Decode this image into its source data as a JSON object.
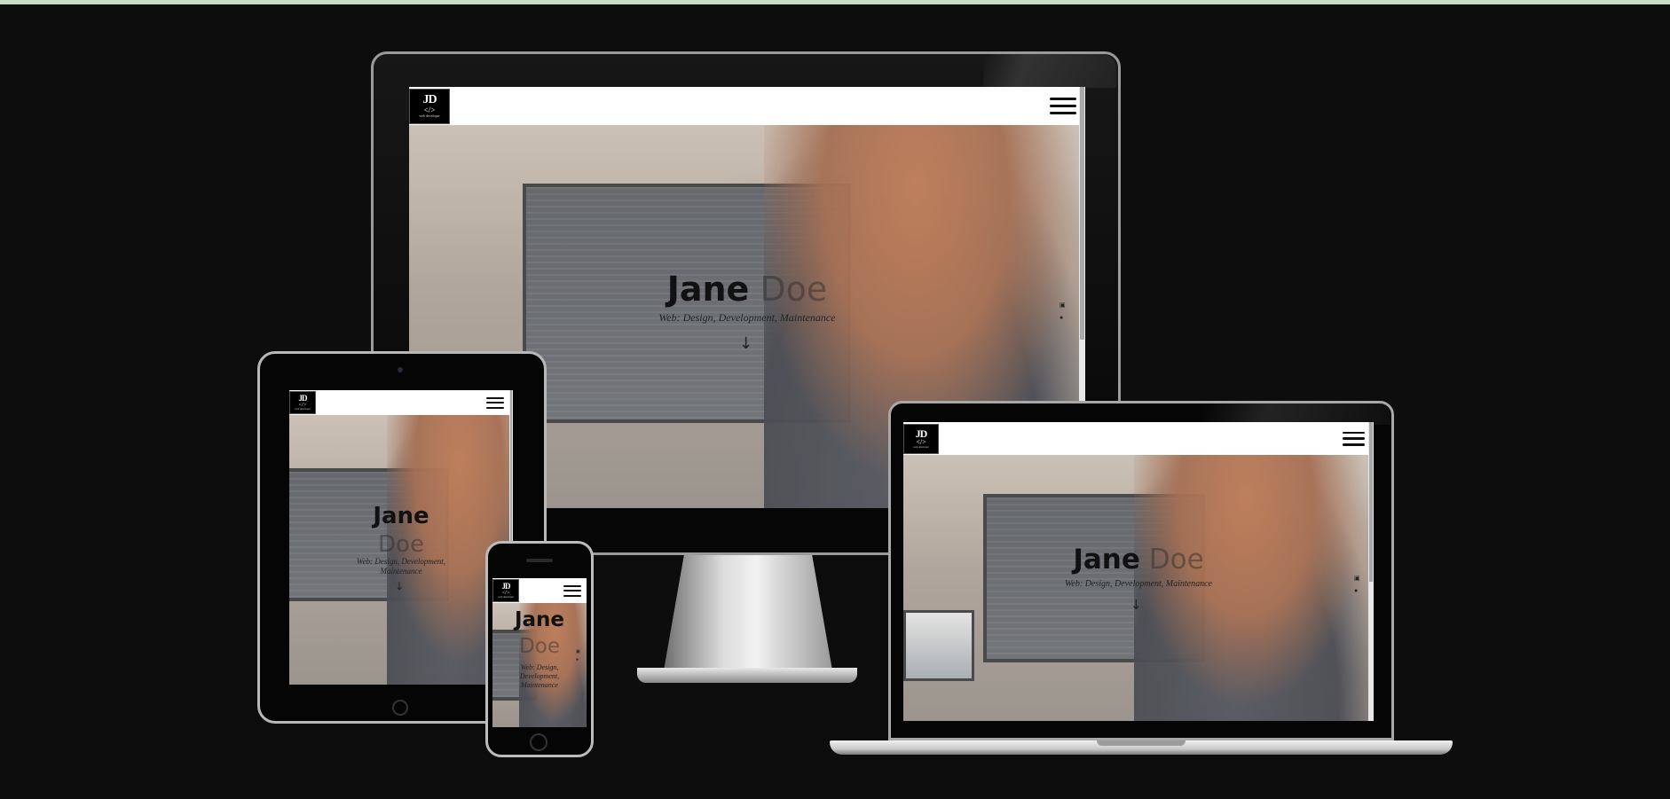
{
  "site": {
    "logo_initials": "JD",
    "logo_code": "</>",
    "logo_tagline": "web developer",
    "menu_icon": "hamburger-menu-icon",
    "first_name": "Jane",
    "last_name": "Doe",
    "subtitle": "Web: Design, Development, Maintenance",
    "scroll_icon": "arrow-down-icon",
    "arrow_glyph": "↓",
    "social_icons": [
      "linkedin-icon",
      "github-icon"
    ],
    "social_glyphs": [
      "▣",
      "●"
    ]
  },
  "colors": {
    "background": "#0e0d0e",
    "header": "#ffffff",
    "title_bold": "#111111",
    "title_light": "#737373"
  }
}
